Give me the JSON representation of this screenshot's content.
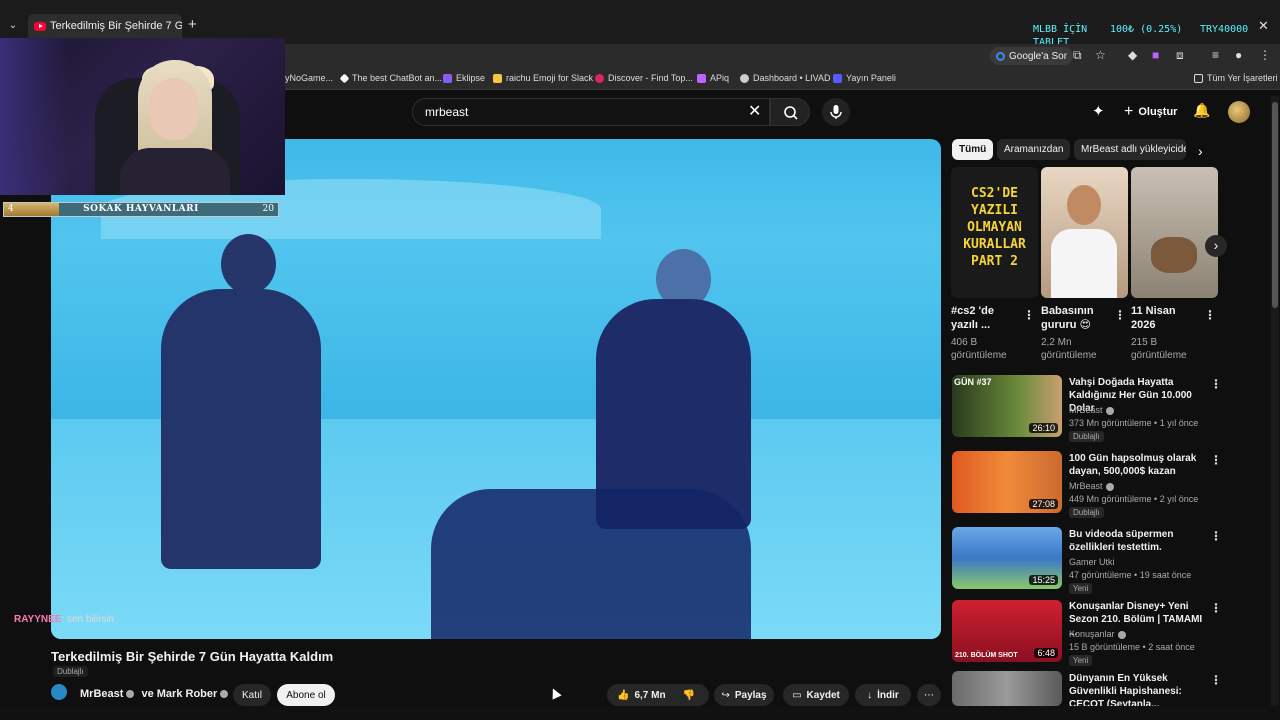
{
  "browser": {
    "tab_title": "Terkedilmiş Bir Şehirde 7 G",
    "overlay_left": "MLBB İÇİN",
    "overlay_left2": "TABLET",
    "overlay_mid": "100₺ (0.25%)",
    "overlay_right": "TRY40000",
    "google_ask": "Google'a Sor"
  },
  "bookmarks": [
    {
      "label": "yNoGame...",
      "color": "#888888"
    },
    {
      "label": "The best ChatBot an...",
      "color": "#ffffff"
    },
    {
      "label": "Eklipse",
      "color": "#8a5cf6"
    },
    {
      "label": "raichu Emoji for Slack",
      "color": "#f5c542"
    },
    {
      "label": "Discover - Find Top...",
      "color": "#e0245e"
    },
    {
      "label": "APiq",
      "color": "#c062ff"
    },
    {
      "label": "Dashboard • LIVAD",
      "color": "#cccccc"
    },
    {
      "label": "Yayın Paneli",
      "color": "#5a5aff"
    }
  ],
  "bookmarks_all": "Tüm Yer İşaretleri",
  "header": {
    "search_value": "mrbeast",
    "create_label": "Oluştur"
  },
  "goal": {
    "current": "4",
    "label": "SOKAK HAYVANLARI",
    "target": "20",
    "progress": 0.2
  },
  "chat": {
    "name": "RAYYNEE",
    "message": ": sen bilirsin"
  },
  "video": {
    "title": "Terkedilmiş Bir Şehirde 7 Gün Hayatta Kaldım",
    "dub": "Dublajlı",
    "channel": "MrBeast",
    "collab": "ve Mark Rober",
    "join": "Katıl",
    "subscribe": "Abone ol",
    "likes": "6,7 Mn",
    "share": "Paylaş",
    "save": "Kaydet",
    "download": "İndir"
  },
  "chips": [
    "Tümü",
    "Aramanızdan",
    "MrBeast adlı yükleyiciden"
  ],
  "shorts": [
    {
      "title": "#cs2 'de yazılı ...",
      "views": "406 B görüntüleme",
      "thumb_text": "CS2'DE YAZILI OLMAYAN KURALLAR PART 2"
    },
    {
      "title": "Babasının gururu 😍",
      "views": "2,2 Mn görüntüleme",
      "thumb_text": ""
    },
    {
      "title": "11 Nisan 2026",
      "views": "215 B görüntüleme",
      "thumb_text": ""
    }
  ],
  "recommendations": [
    {
      "title": "Vahşi Doğada Hayatta Kaldığınız Her Gün 10.000 Dolar",
      "channel": "MrBeast",
      "meta": "373 Mn görüntüleme • 1 yıl önce",
      "badge": "Dublajlı",
      "duration": "26:10",
      "thumb_label": "GÜN #37"
    },
    {
      "title": "100 Gün hapsolmuş olarak dayan, 500,000$ kazan",
      "channel": "MrBeast",
      "meta": "449 Mn görüntüleme • 2 yıl önce",
      "badge": "Dublajlı",
      "duration": "27:08",
      "thumb_label": ""
    },
    {
      "title": "Bu videoda süpermen özellikleri testettim.",
      "channel": "Gamer Utki",
      "meta": "47 görüntüleme • 19 saat önce",
      "badge": "Yeni",
      "duration": "15:25",
      "thumb_label": ""
    },
    {
      "title": "Konuşanlar Disney+ Yeni Sezon 210. Bölüm | TAMAMI ...",
      "channel": "Konuşanlar",
      "meta": "15 B görüntüleme • 2 saat önce",
      "badge": "Yeni",
      "duration": "6:48",
      "thumb_label": "210. BÖLÜM SHOT"
    },
    {
      "title": "Dünyanın En Yüksek Güvenlikli Hapishanesi: CECOT (Şeytanla...",
      "channel": "",
      "meta": "",
      "badge": "",
      "duration": "",
      "thumb_label": ""
    }
  ],
  "colors": {
    "accent": "#ff0033",
    "background": "#0f0f0f",
    "video_tint": "#3fb8e8"
  }
}
